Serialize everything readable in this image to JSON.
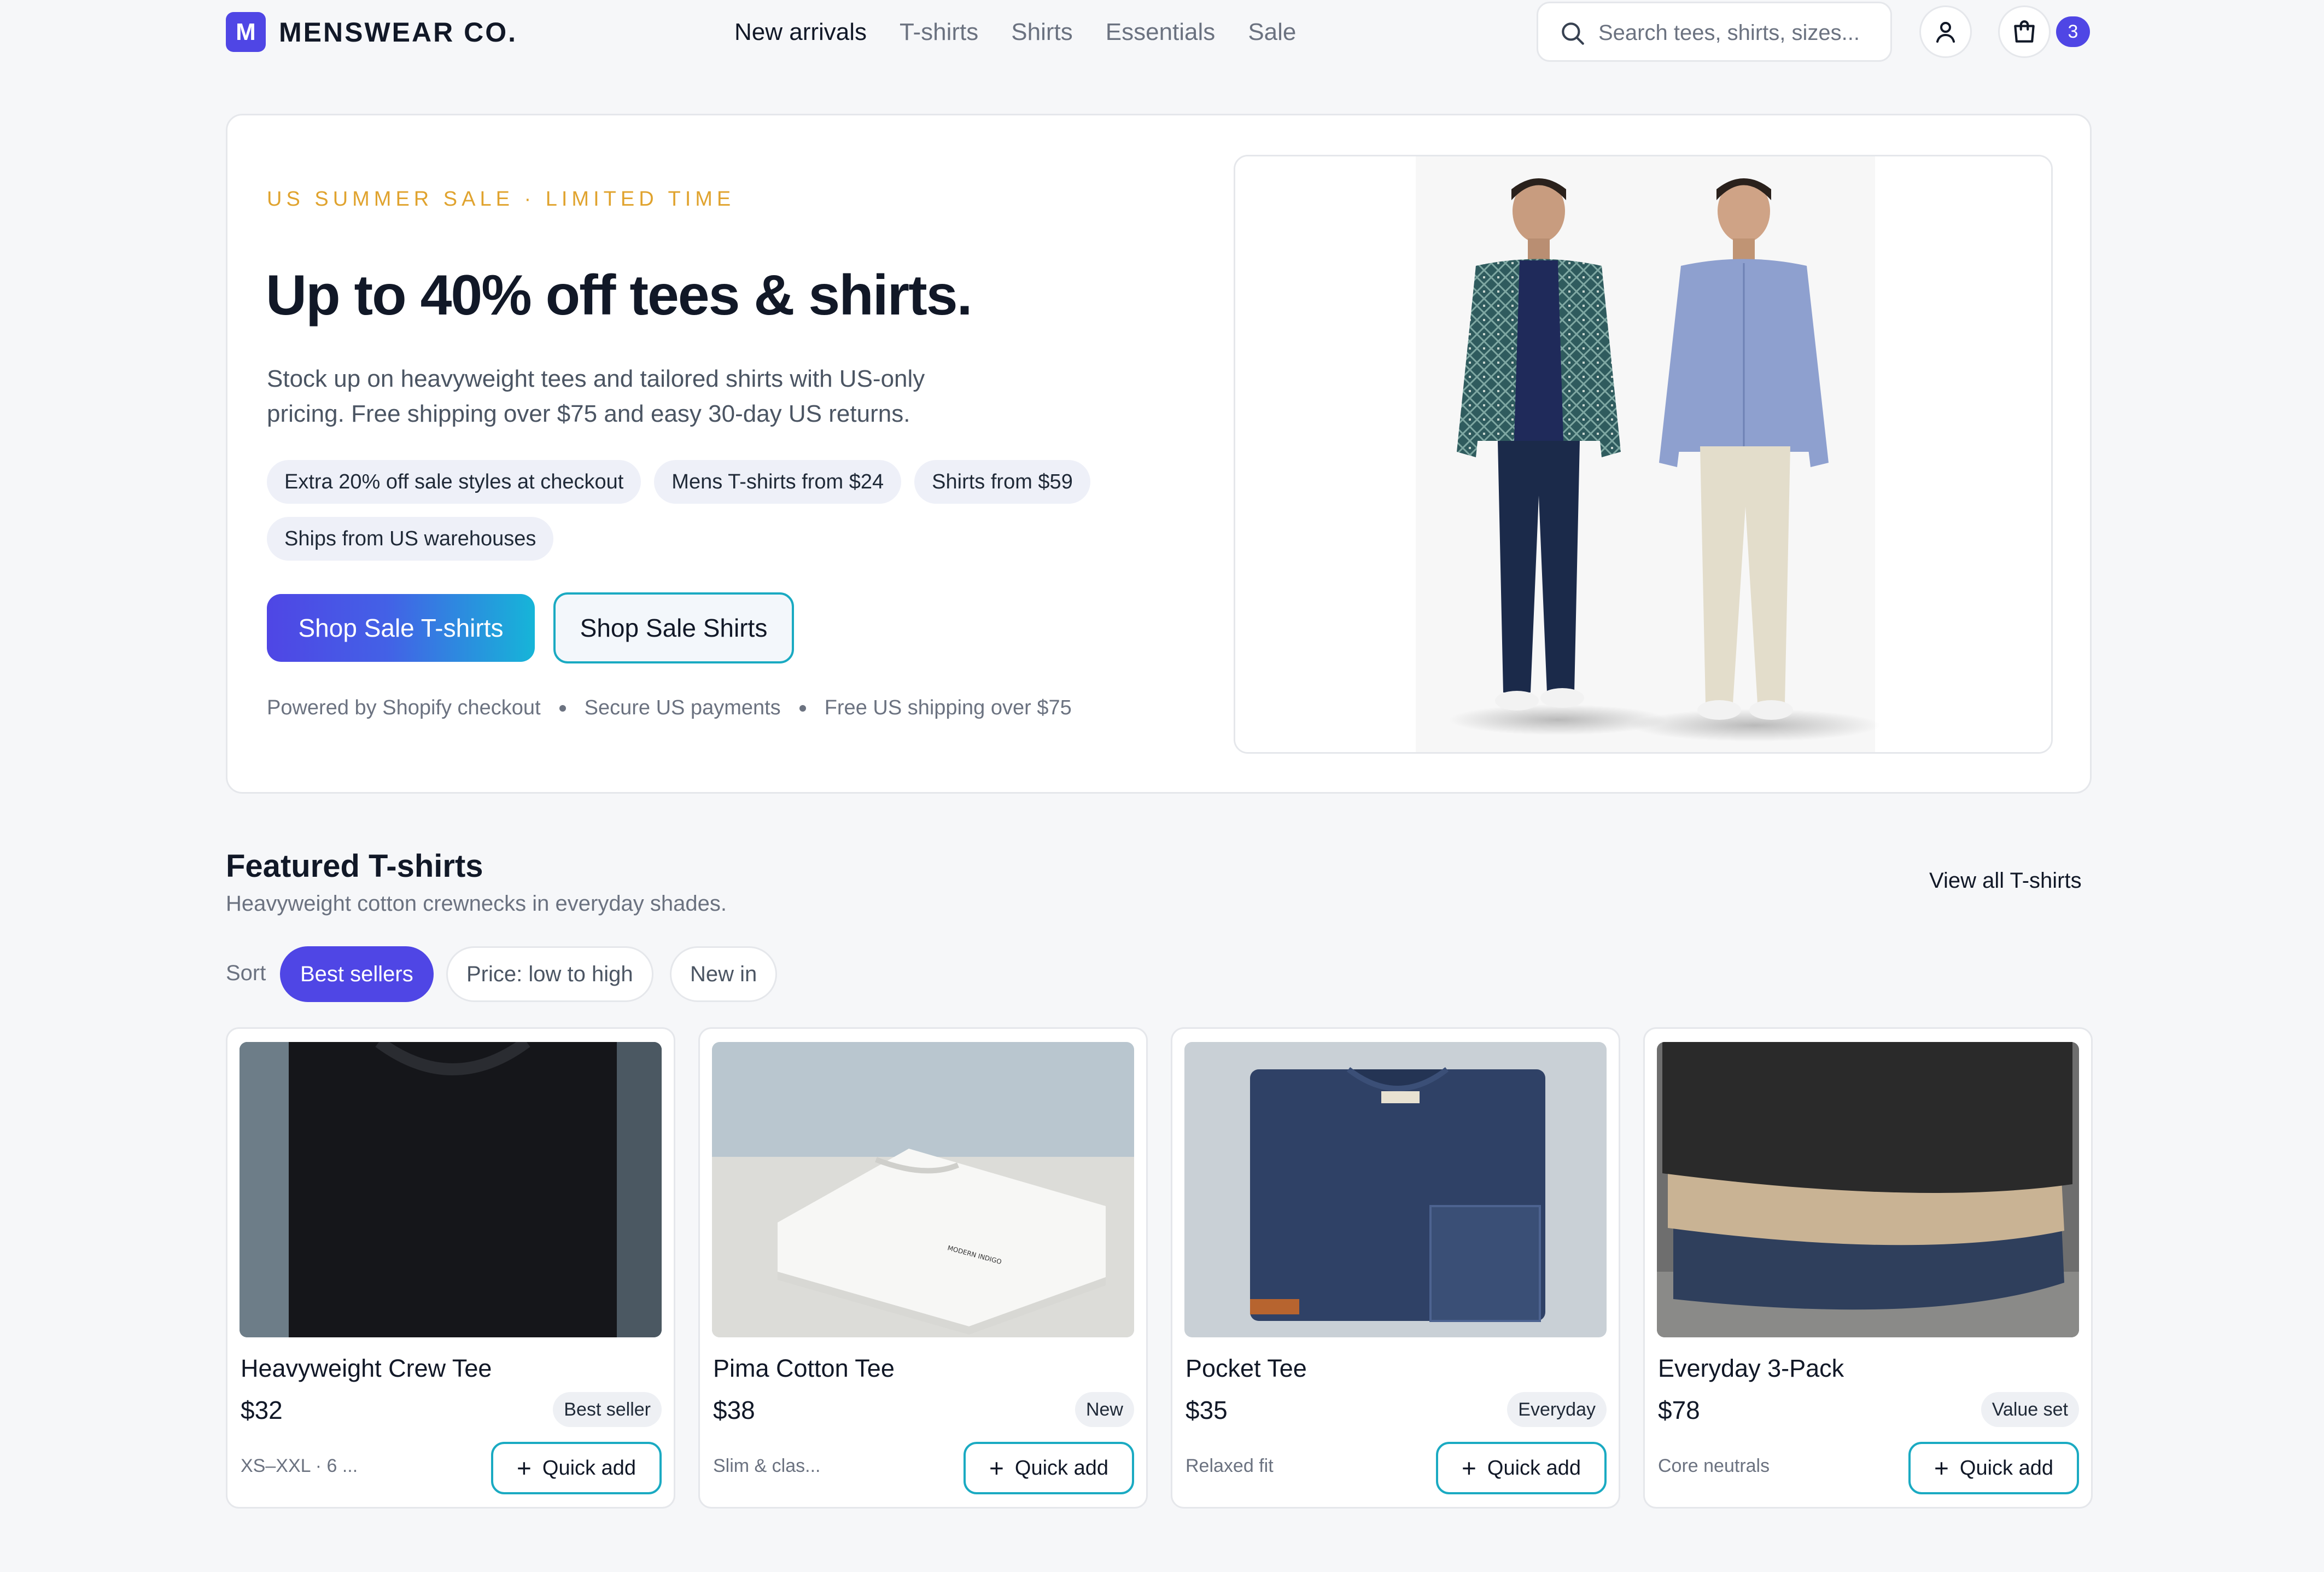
{
  "brand": {
    "logo_letter": "M",
    "name": "MENSWEAR CO.",
    "accent": "#4f46e5"
  },
  "nav": {
    "items": [
      "New arrivals",
      "T-shirts",
      "Shirts",
      "Essentials",
      "Sale"
    ],
    "active": "New arrivals"
  },
  "search": {
    "placeholder": "Search tees, shirts, sizes...",
    "value": ""
  },
  "cart": {
    "count": "3"
  },
  "hero": {
    "eyebrow": "US SUMMER SALE · LIMITED TIME",
    "title": "Up to 40% off tees & shirts.",
    "description": "Stock up on heavyweight tees and tailored shirts with US-only pricing. Free shipping over $75 and easy 30-day US returns.",
    "pills": [
      "Extra 20% off sale styles at checkout",
      "Mens T-shirts from $24",
      "Shirts from $59",
      "Ships from US warehouses"
    ],
    "primary_cta": "Shop Sale T-shirts",
    "secondary_cta": "Shop Sale Shirts",
    "trust": [
      "Powered by Shopify checkout",
      "Secure US payments",
      "Free US shipping over $75"
    ]
  },
  "featured": {
    "title": "Featured T-shirts",
    "subtitle": "Heavyweight cotton crewnecks in everyday shades.",
    "view_all": "View all T-shirts",
    "sort_label": "Sort",
    "sort_options": [
      "Best sellers",
      "Price: low to high",
      "New in"
    ],
    "sort_active": "Best sellers",
    "quick_add_label": "Quick add",
    "products": [
      {
        "name": "Heavyweight Crew Tee",
        "price": "$32",
        "tag": "Best seller",
        "meta": "XS–XXL · 6 ..."
      },
      {
        "name": "Pima Cotton Tee",
        "price": "$38",
        "tag": "New",
        "meta": "Slim & clas..."
      },
      {
        "name": "Pocket Tee",
        "price": "$35",
        "tag": "Everyday",
        "meta": "Relaxed fit"
      },
      {
        "name": "Everyday 3-Pack",
        "price": "$78",
        "tag": "Value set",
        "meta": "Core neutrals"
      }
    ]
  }
}
